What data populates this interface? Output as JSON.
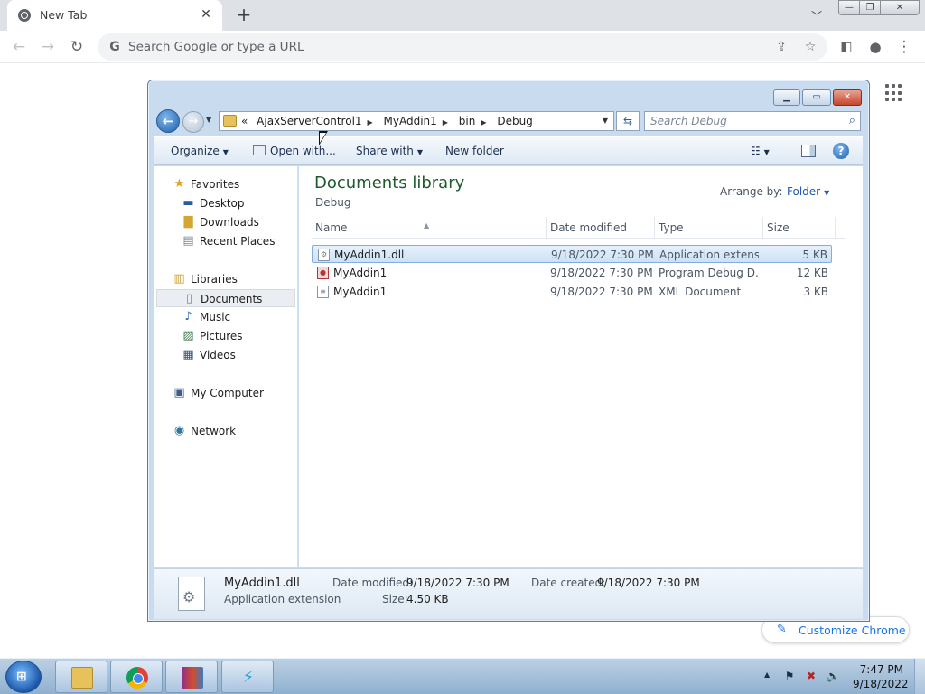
{
  "browser": {
    "tab_title": "New Tab",
    "omnibox_placeholder": "Search Google or type a URL",
    "customize_label": "Customize Chrome"
  },
  "explorer": {
    "breadcrumb": [
      "AjaxServerControl1",
      "MyAddin1",
      "bin",
      "Debug"
    ],
    "breadcrumb_overflow": "«",
    "search_placeholder": "Search Debug",
    "commands": {
      "organize": "Organize",
      "open_with": "Open with...",
      "share_with": "Share with",
      "new_folder": "New folder"
    },
    "nav": {
      "favorites": "Favorites",
      "desktop": "Desktop",
      "downloads": "Downloads",
      "recent_places": "Recent Places",
      "libraries": "Libraries",
      "documents": "Documents",
      "music": "Music",
      "pictures": "Pictures",
      "videos": "Videos",
      "my_computer": "My Computer",
      "network": "Network"
    },
    "library": {
      "title": "Documents library",
      "subtitle": "Debug",
      "arrange_label": "Arrange by:",
      "arrange_value": "Folder"
    },
    "columns": {
      "name": "Name",
      "date": "Date modified",
      "type": "Type",
      "size": "Size"
    },
    "files": [
      {
        "name": "MyAddin1.dll",
        "date": "9/18/2022 7:30 PM",
        "type": "Application extens...",
        "size": "5 KB"
      },
      {
        "name": "MyAddin1",
        "date": "9/18/2022 7:30 PM",
        "type": "Program Debug D...",
        "size": "12 KB"
      },
      {
        "name": "MyAddin1",
        "date": "9/18/2022 7:30 PM",
        "type": "XML Document",
        "size": "3 KB"
      }
    ],
    "details": {
      "name": "MyAddin1.dll",
      "type": "Application extension",
      "modified_label": "Date modified:",
      "modified_value": "9/18/2022 7:30 PM",
      "created_label": "Date created:",
      "created_value": "9/18/2022 7:30 PM",
      "size_label": "Size:",
      "size_value": "4.50 KB"
    }
  },
  "taskbar": {
    "time": "7:47 PM",
    "date": "9/18/2022"
  },
  "colors": {
    "chrome_tabstrip": "#dee1e6",
    "explorer_frame": "#c9dcef",
    "library_title": "#1e5a2d",
    "selection": "#cde2f7",
    "taskbar": "#8fb0cf"
  }
}
